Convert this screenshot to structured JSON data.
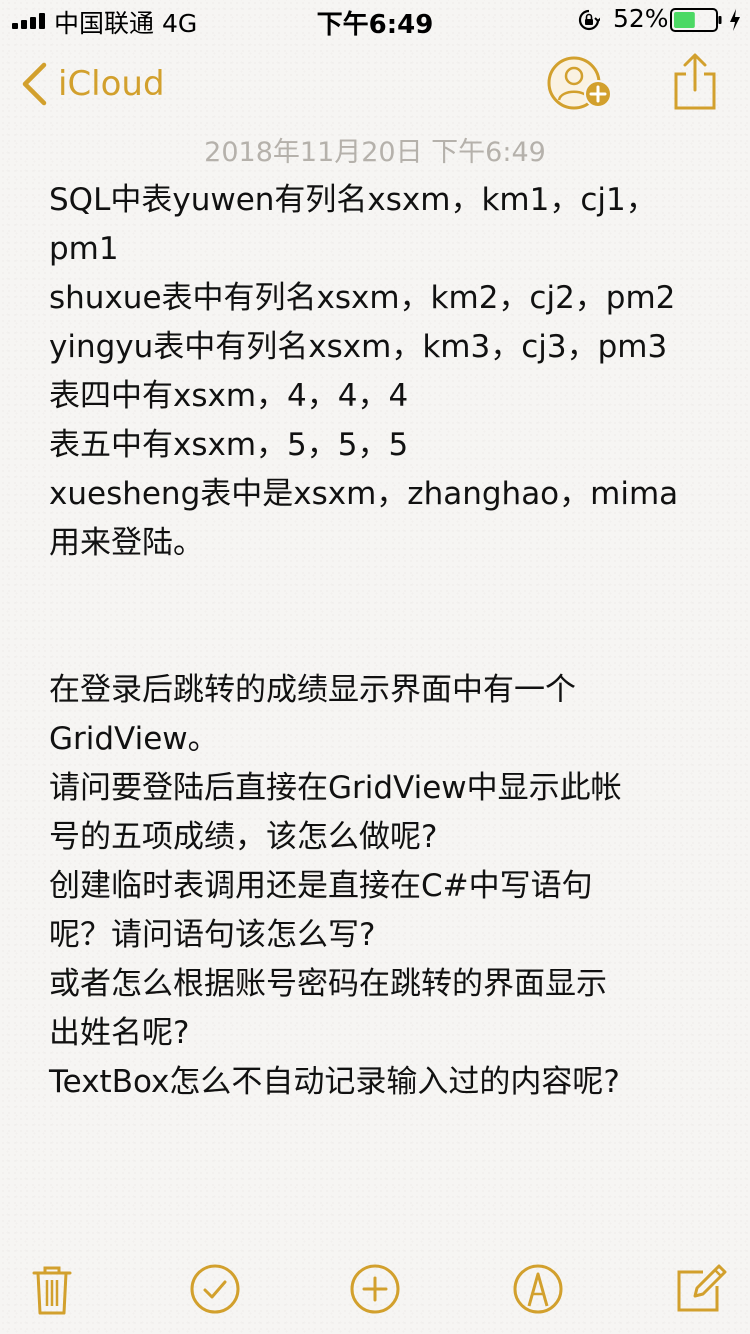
{
  "status_bar": {
    "carrier": "中国联通   4G",
    "time": "下午6:49",
    "battery_percent": "52%",
    "signal_bars": 4,
    "battery_level": 0.52
  },
  "nav": {
    "back_label": "iCloud",
    "back_icon": "chevron-left-icon",
    "add_person_icon": "add-person-icon",
    "share_icon": "share-icon"
  },
  "note": {
    "date": "2018年11月20日 下午6:49",
    "lines": [
      "SQL中表yuwen有列名xsxm，km1，cj1，",
      "pm1",
      "shuxue表中有列名xsxm，km2，cj2，pm2",
      "yingyu表中有列名xsxm，km3，cj3，pm3",
      "表四中有xsxm，4，4，4",
      "表五中有xsxm，5，5，5",
      "xuesheng表中是xsxm，zhanghao，mima",
      "用来登陆。",
      "",
      "",
      "在登录后跳转的成绩显示界面中有一个",
      "GridView。",
      "请问要登陆后直接在GridView中显示此帐",
      "号的五项成绩，该怎么做呢?",
      "创建临时表调用还是直接在C#中写语句",
      "呢？请问语句该怎么写?",
      "或者怎么根据账号密码在跳转的界面显示",
      "出姓名呢?",
      "TextBox怎么不自动记录输入过的内容呢?"
    ]
  },
  "toolbar": {
    "items": [
      "trash-icon",
      "checklist-icon",
      "add-icon",
      "markup-icon",
      "compose-icon"
    ]
  },
  "colors": {
    "accent": "#d2a02d",
    "date_text": "#b5b1ab",
    "background": "#f6f5f3",
    "battery_fill": "#4cd964"
  }
}
